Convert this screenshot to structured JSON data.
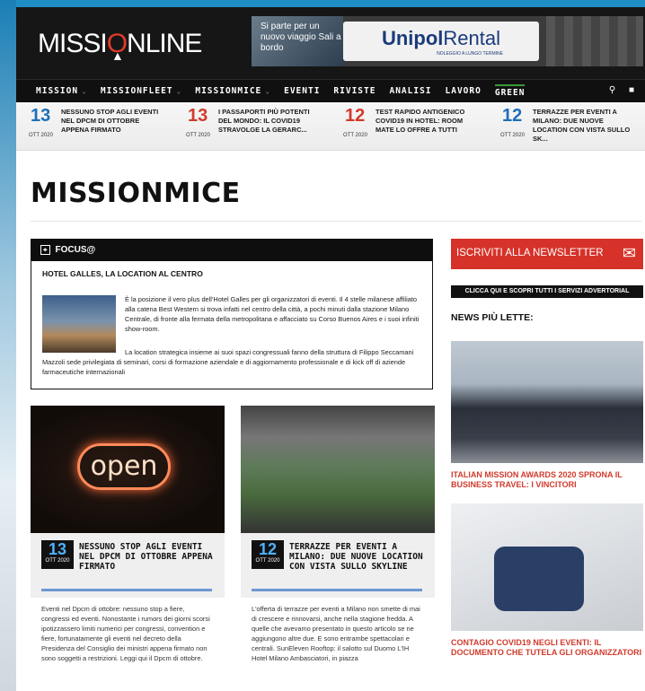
{
  "header": {
    "logo": {
      "part1": "MISSI",
      "part2": "O",
      "part3": "NLINE"
    },
    "ad": {
      "text": "Si parte per un nuovo viaggio Sali a bordo",
      "brand": "Unipol",
      "brand2": "Rental",
      "tagline": "NOLEGGIO A LUNGO TERMINE"
    }
  },
  "nav": {
    "items": [
      {
        "label": "MISSION",
        "caret": true
      },
      {
        "label": "MISSIONFLEET",
        "caret": true
      },
      {
        "label": "MISSIONMICE",
        "caret": true
      },
      {
        "label": "EVENTI",
        "caret": false
      },
      {
        "label": "RIVISTE",
        "caret": false
      },
      {
        "label": "ANALISI",
        "caret": false
      },
      {
        "label": "LAVORO",
        "caret": false
      },
      {
        "label": "GREEN",
        "caret": false
      }
    ],
    "caret_glyph": "⌄"
  },
  "ticker": [
    {
      "day": "13",
      "month": "OTT 2020",
      "text": "NESSUNO STOP AGLI EVENTI NEL DPCM DI OTTOBRE APPENA FIRMATO"
    },
    {
      "day": "13",
      "month": "OTT 2020",
      "text": "I PASSAPORTI PIÙ POTENTI DEL MONDO: IL COVID19 STRAVOLGE LA GERARC..."
    },
    {
      "day": "12",
      "month": "OTT 2020",
      "text": "TEST RAPIDO ANTIGENICO COVID19 IN HOTEL: ROOM MATE LO OFFRE A TUTTI"
    },
    {
      "day": "12",
      "month": "OTT 2020",
      "text": "TERRAZZE PER EVENTI A MILANO: DUE NUOVE LOCATION CON VISTA SULLO SK..."
    }
  ],
  "section_title": "MISSIONMICE",
  "focus": {
    "header": "FOCUS@",
    "subtitle": "HOTEL GALLES, LA LOCATION AL CENTRO",
    "p1": "È la posizione il vero plus dell'Hotel Galles per gli organizzatori di eventi. Il 4 stelle milanese affiliato alla catena Best Western si trova infatti nel centro della città, a pochi minuti dalla stazione Milano Centrale, di fronte alla fermata della metropolitana e affacciato su Corso Buenos Aires e i suoi infiniti show-room.",
    "p2": "La location strategica insieme ai suoi spazi congressuali fanno della struttura di Filippo Seccamani Mazzoli sede privilegiata di seminari, corsi di formazione aziendale e di aggiornamento professionale e di kick off di aziende farmaceutiche internazionali"
  },
  "cards": [
    {
      "day": "13",
      "month": "OTT 2020",
      "title": "NESSUNO STOP AGLI EVENTI NEL DPCM DI OTTOBRE APPENA FIRMATO",
      "neon": "open",
      "body": "Eventi nel Dpcm di ottobre: nessuno stop a fiere, congressi ed eventi. Nonostante i rumors dei giorni scorsi ipotizzassero limiti numerici per congressi, convention e fiere, fortunatamente gli eventi nel decreto della Presidenza del Consiglio dei ministri appena firmato non sono soggetti a restrizioni. Leggi qui il Dpcm di ottobre."
    },
    {
      "day": "12",
      "month": "OTT 2020",
      "title": "TERRAZZE PER EVENTI A MILANO: DUE NUOVE LOCATION CON VISTA SULLO SKYLINE",
      "body": "L'offerta di terrazze per eventi a Milano non smette di mai di crescere e rinnovarsi, anche nella stagione fredda. A quelle che avevamo presentato in questo articolo se ne aggiungono altre due. E sono entrambe spettacolari e centrali. SunEleven Rooftop: il salotto sul Duomo L'IH Hotel Milano Ambasciatori, in piazza"
    }
  ],
  "sidebar": {
    "newsletter": "ISCRIVITI ALLA NEWSLETTER",
    "services": "CLICCA QUI E SCOPRI TUTTI I SERVIZI ADVERTORIAL",
    "news_header": "NEWS PIÙ LETTE:",
    "news": [
      {
        "title": "ITALIAN MISSION AWARDS 2020 SPRONA IL BUSINESS TRAVEL: I VINCITORI"
      },
      {
        "title": "CONTAGIO COVID19 NEGLI EVENTI: IL DOCUMENTO CHE TUTELA GLI ORGANIZZATORI"
      }
    ]
  },
  "icons": {
    "search": "search-icon",
    "lock": "lock-icon",
    "envelope": "envelope-icon"
  },
  "colors": {
    "accent_blue": "#1d6fb8",
    "newsletter_red": "#d63229",
    "news_red": "#d13a2c",
    "green_tab": "#3a9a3a"
  }
}
